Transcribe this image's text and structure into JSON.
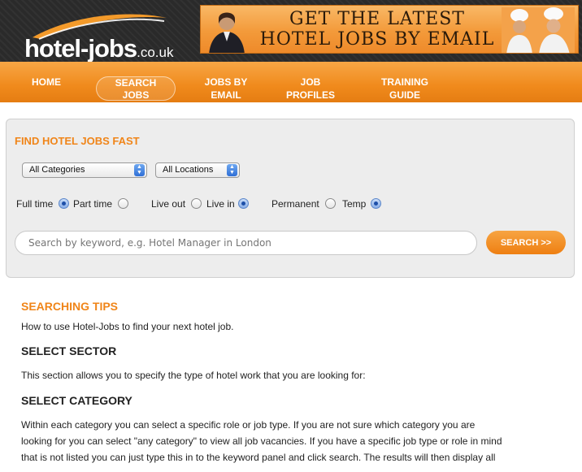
{
  "header": {
    "logo_text": "hotel-jobs",
    "logo_tld": ".co.uk",
    "banner_line1": "GET THE LATEST",
    "banner_line2": "HOTEL JOBS BY EMAIL"
  },
  "nav": {
    "items": [
      {
        "line1": "HOME",
        "line2": ""
      },
      {
        "line1": "SEARCH",
        "line2": "JOBS"
      },
      {
        "line1": "JOBS BY",
        "line2": "EMAIL"
      },
      {
        "line1": "JOB",
        "line2": "PROFILES"
      },
      {
        "line1": "TRAINING",
        "line2": "GUIDE"
      }
    ]
  },
  "search_panel": {
    "title": "FIND HOTEL JOBS FAST",
    "category_select": "All Categories",
    "location_select": "All Locations",
    "radios": {
      "full_time": "Full time",
      "part_time": "Part time",
      "live_out": "Live out",
      "live_in": "Live in",
      "permanent": "Permanent",
      "temp": "Temp"
    },
    "search_placeholder": "Search by keyword, e.g. Hotel Manager in London",
    "search_button": "SEARCH >>"
  },
  "content": {
    "tips_heading": "SEARCHING TIPS",
    "tips_text": "How to use Hotel-Jobs to find your next hotel job.",
    "sector_heading": "SELECT SECTOR",
    "sector_text": "This section allows you to specify the type of hotel work that you are looking for:",
    "category_heading": "SELECT CATEGORY",
    "category_line1": "Within each category you can select a specific role or job type. If you are not sure which category you are",
    "category_line2": "looking for you can select \"any category\" to view all job vacancies. If you have a specific job type or role in mind",
    "category_line3": "that is not listed you can just type this in to the keyword panel and click search. The results will then display all"
  },
  "colors": {
    "accent": "#f08519",
    "nav": "#f08a1c",
    "header_bg": "#2a2a2a",
    "panel_bg": "#ededed"
  }
}
